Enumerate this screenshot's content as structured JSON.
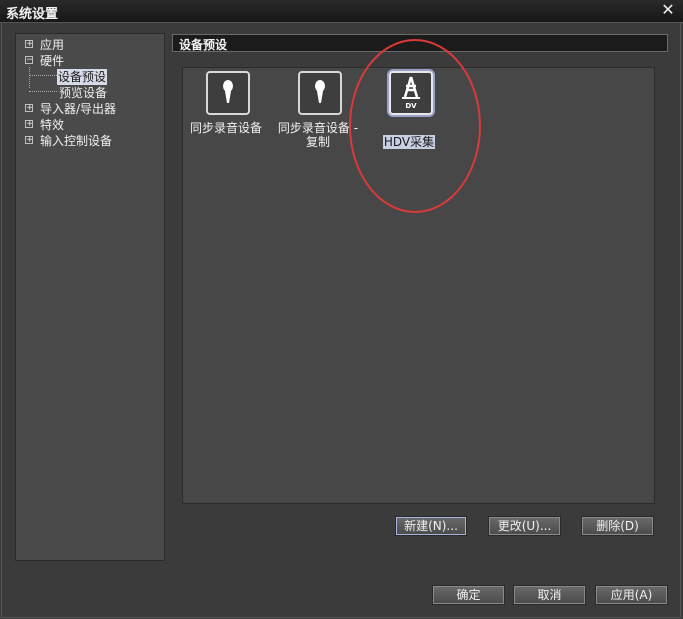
{
  "window": {
    "title": "系统设置",
    "close_glyph": "✕"
  },
  "tree": {
    "items": [
      {
        "label": "应用",
        "expander": "+"
      },
      {
        "label": "硬件",
        "expander": "−"
      },
      {
        "label": "设备预设",
        "selected": true
      },
      {
        "label": "预览设备"
      },
      {
        "label": "导入器/导出器",
        "expander": "+"
      },
      {
        "label": "特效",
        "expander": "+"
      },
      {
        "label": "输入控制设备",
        "expander": "+"
      }
    ]
  },
  "panel": {
    "title": "设备预设"
  },
  "devices": [
    {
      "label": "同步录音设备",
      "icon": "microphone-icon"
    },
    {
      "label": "同步录音设备 -\n复制",
      "icon": "microphone-icon"
    },
    {
      "label": "HDV采集",
      "icon": "hdv-icon",
      "icon_text": "DV",
      "selected": true
    }
  ],
  "preset_buttons": {
    "new": "新建(N)...",
    "edit": "更改(U)...",
    "delete": "删除(D)"
  },
  "dialog_buttons": {
    "ok": "确定",
    "cancel": "取消",
    "apply": "应用(A)"
  },
  "colors": {
    "annotation": "#d93a3a",
    "selection": "#d7dbe8"
  }
}
